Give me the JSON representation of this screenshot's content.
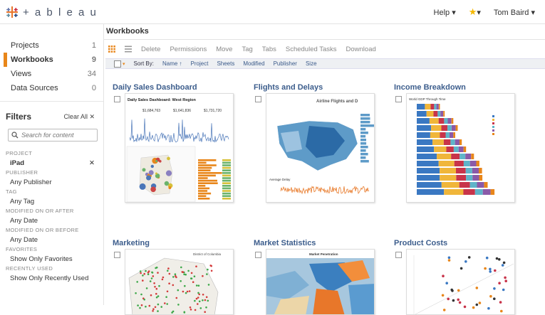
{
  "app": {
    "logo_text": "+ a b l e a u",
    "help_label": "Help ▾",
    "favorites_label": "▾",
    "user_label": "Tom Baird ▾"
  },
  "sidebar": {
    "nav": [
      {
        "label": "Projects",
        "count": "1"
      },
      {
        "label": "Workbooks",
        "count": "9"
      },
      {
        "label": "Views",
        "count": "34"
      },
      {
        "label": "Data Sources",
        "count": "0"
      }
    ],
    "filters_title": "Filters",
    "clear_all": "Clear All ✕",
    "search_placeholder": "Search for content",
    "filters": {
      "project_label": "PROJECT",
      "project_value": "iPad",
      "publisher_label": "PUBLISHER",
      "publisher_value": "Any Publisher",
      "tag_label": "TAG",
      "tag_value": "Any Tag",
      "modified_after_label": "MODIFIED ON OR AFTER",
      "modified_after_value": "Any Date",
      "modified_before_label": "MODIFIED ON OR BEFORE",
      "modified_before_value": "Any Date",
      "favorites_label": "FAVORITES",
      "favorites_value": "Show Only Favorites",
      "recent_label": "RECENTLY USED",
      "recent_value": "Show Only Recently Used"
    }
  },
  "main": {
    "title": "Workbooks",
    "toolbar": [
      "Delete",
      "Permissions",
      "Move",
      "Tag",
      "Tabs",
      "Scheduled Tasks",
      "Download"
    ],
    "sort_by_label": "Sort By:",
    "sort_options": [
      "Name ↑",
      "Project",
      "Sheets",
      "Modified",
      "Publisher",
      "Size"
    ],
    "cards": [
      {
        "title": "Daily Sales Dashboard",
        "thumb_title": "Daily Sales Dashboard: West Region",
        "kpis": [
          "$1,684,763",
          "$1,641,836",
          "$1,731,720"
        ]
      },
      {
        "title": "Flights and Delays",
        "thumb_title": "Airline Flights and D"
      },
      {
        "title": "Income Breakdown",
        "thumb_title": "World GDP Through Time"
      },
      {
        "title": "Marketing",
        "thumb_title": "District of Columbia"
      },
      {
        "title": "Market Statistics",
        "thumb_title": "Market Penetration"
      },
      {
        "title": "Product Costs",
        "thumb_title": ""
      }
    ]
  },
  "colors": {
    "accent": "#e8861a",
    "link": "#3c5d8c"
  }
}
